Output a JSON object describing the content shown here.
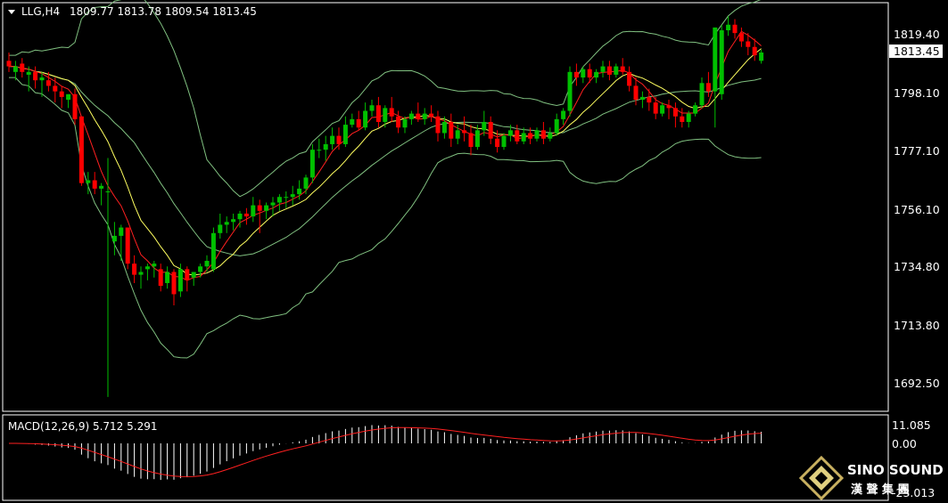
{
  "header": {
    "symbol": "LLG,H4",
    "ohlc": "1809.77 1813.78 1809.54 1813.45"
  },
  "macd": {
    "label": "MACD(12,26,9) 5.712 5.291",
    "ticks": [
      "11.085",
      "0.00",
      "-23.013"
    ]
  },
  "price_axis": {
    "ticks": [
      "1819.40",
      "1798.10",
      "1777.10",
      "1756.10",
      "1734.80",
      "1713.80",
      "1692.50"
    ],
    "current": "1813.45"
  },
  "brand": {
    "name": "SINO SOUND",
    "cn": "漢 聲 集 團"
  },
  "colors": {
    "background": "#000000",
    "up": "#00c000",
    "down": "#ff0000",
    "bollinger": "#80c080",
    "ma_fast": "#ff2020",
    "ma_slow": "#ffff60",
    "macd_hist": "#ffffff",
    "macd_signal": "#ff2020"
  },
  "chart_data": {
    "type": "candlestick",
    "symbol": "LLG",
    "timeframe": "H4",
    "y_ticks": [
      1819.4,
      1798.1,
      1777.1,
      1756.1,
      1734.8,
      1713.8,
      1692.5
    ],
    "last_price": 1813.45,
    "candles": [
      [
        1810,
        1813,
        1808,
        1806
      ],
      [
        1806,
        1810,
        1808,
        1803
      ],
      [
        1809,
        1811,
        1806,
        1804
      ],
      [
        1805,
        1808,
        1806,
        1799
      ],
      [
        1806,
        1808,
        1803,
        1800
      ],
      [
        1803,
        1806,
        1804,
        1797
      ],
      [
        1803,
        1806,
        1801,
        1799
      ],
      [
        1801,
        1804,
        1799,
        1795
      ],
      [
        1799,
        1801,
        1797,
        1793
      ],
      [
        1796,
        1798,
        1798,
        1793
      ],
      [
        1798,
        1800,
        1789,
        1787
      ],
      [
        1790,
        1790,
        1766,
        1765
      ],
      [
        1766,
        1770,
        1767,
        1762
      ],
      [
        1767,
        1770,
        1764,
        1762
      ],
      [
        1764,
        1766,
        1765,
        1758
      ],
      [
        1763,
        1775,
        1763,
        1689
      ],
      [
        1745,
        1752,
        1747,
        1740
      ],
      [
        1747,
        1751,
        1750,
        1738
      ],
      [
        1750,
        1749,
        1737,
        1735
      ],
      [
        1737,
        1740,
        1733,
        1730
      ],
      [
        1733,
        1736,
        1734,
        1728
      ],
      [
        1735,
        1737,
        1736,
        1731
      ],
      [
        1736,
        1738,
        1737,
        1732
      ],
      [
        1735,
        1737,
        1729,
        1727
      ],
      [
        1730,
        1736,
        1734,
        1728
      ],
      [
        1734,
        1735,
        1726,
        1722
      ],
      [
        1727,
        1737,
        1735,
        1725
      ],
      [
        1735,
        1736,
        1731,
        1727
      ],
      [
        1732,
        1734,
        1734,
        1729
      ],
      [
        1734,
        1737,
        1736,
        1732
      ],
      [
        1736,
        1740,
        1738,
        1734
      ],
      [
        1735,
        1750,
        1748,
        1734
      ],
      [
        1748,
        1755,
        1751,
        1746
      ],
      [
        1751,
        1754,
        1752,
        1748
      ],
      [
        1752,
        1755,
        1753,
        1749
      ],
      [
        1753,
        1756,
        1755,
        1750
      ],
      [
        1755,
        1757,
        1754,
        1751
      ],
      [
        1754,
        1761,
        1758,
        1752
      ],
      [
        1758,
        1760,
        1756,
        1748
      ],
      [
        1756,
        1759,
        1758,
        1753
      ],
      [
        1758,
        1761,
        1759,
        1754
      ],
      [
        1759,
        1762,
        1761,
        1756
      ],
      [
        1761,
        1763,
        1761,
        1757
      ],
      [
        1761,
        1765,
        1762,
        1758
      ],
      [
        1762,
        1767,
        1764,
        1760
      ],
      [
        1764,
        1769,
        1768,
        1762
      ],
      [
        1768,
        1780,
        1778,
        1766
      ],
      [
        1778,
        1782,
        1778,
        1775
      ],
      [
        1778,
        1783,
        1780,
        1774
      ],
      [
        1780,
        1786,
        1783,
        1778
      ],
      [
        1783,
        1786,
        1780,
        1778
      ],
      [
        1780,
        1790,
        1787,
        1779
      ],
      [
        1787,
        1791,
        1789,
        1786
      ],
      [
        1789,
        1792,
        1786,
        1785
      ],
      [
        1786,
        1795,
        1792,
        1785
      ],
      [
        1792,
        1796,
        1794,
        1790
      ],
      [
        1794,
        1797,
        1788,
        1786
      ],
      [
        1788,
        1794,
        1793,
        1786
      ],
      [
        1793,
        1797,
        1790,
        1788
      ],
      [
        1790,
        1792,
        1786,
        1784
      ],
      [
        1786,
        1790,
        1789,
        1784
      ],
      [
        1789,
        1792,
        1791,
        1787
      ],
      [
        1791,
        1795,
        1789,
        1788
      ],
      [
        1789,
        1793,
        1791,
        1787
      ],
      [
        1791,
        1794,
        1790,
        1788
      ],
      [
        1790,
        1792,
        1784,
        1781
      ],
      [
        1784,
        1790,
        1788,
        1782
      ],
      [
        1788,
        1791,
        1782,
        1779
      ],
      [
        1782,
        1787,
        1785,
        1780
      ],
      [
        1785,
        1790,
        1784,
        1781
      ],
      [
        1784,
        1787,
        1779,
        1776
      ],
      [
        1779,
        1787,
        1785,
        1778
      ],
      [
        1785,
        1792,
        1788,
        1783
      ],
      [
        1788,
        1790,
        1782,
        1780
      ],
      [
        1782,
        1785,
        1779,
        1777
      ],
      [
        1779,
        1784,
        1783,
        1778
      ],
      [
        1783,
        1787,
        1785,
        1781
      ],
      [
        1785,
        1787,
        1781,
        1780
      ],
      [
        1781,
        1786,
        1784,
        1780
      ],
      [
        1784,
        1786,
        1782,
        1780
      ],
      [
        1782,
        1786,
        1785,
        1781
      ],
      [
        1785,
        1788,
        1782,
        1780
      ],
      [
        1782,
        1786,
        1784,
        1781
      ],
      [
        1784,
        1791,
        1789,
        1783
      ],
      [
        1789,
        1793,
        1792,
        1787
      ],
      [
        1792,
        1808,
        1806,
        1790
      ],
      [
        1806,
        1809,
        1804,
        1801
      ],
      [
        1804,
        1808,
        1807,
        1802
      ],
      [
        1807,
        1809,
        1804,
        1802
      ],
      [
        1804,
        1807,
        1806,
        1802
      ],
      [
        1806,
        1810,
        1808,
        1804
      ],
      [
        1808,
        1810,
        1805,
        1803
      ],
      [
        1805,
        1809,
        1808,
        1804
      ],
      [
        1808,
        1811,
        1806,
        1805
      ],
      [
        1806,
        1808,
        1801,
        1799
      ],
      [
        1801,
        1804,
        1796,
        1794
      ],
      [
        1796,
        1799,
        1797,
        1793
      ],
      [
        1797,
        1800,
        1795,
        1792
      ],
      [
        1795,
        1797,
        1791,
        1789
      ],
      [
        1791,
        1795,
        1794,
        1790
      ],
      [
        1794,
        1796,
        1793,
        1789
      ],
      [
        1793,
        1795,
        1790,
        1786
      ],
      [
        1790,
        1793,
        1788,
        1786
      ],
      [
        1788,
        1792,
        1791,
        1786
      ],
      [
        1791,
        1795,
        1794,
        1790
      ],
      [
        1794,
        1804,
        1802,
        1793
      ],
      [
        1802,
        1806,
        1799,
        1797
      ],
      [
        1799,
        1806,
        1822,
        1786
      ],
      [
        1798,
        1823,
        1821,
        1796
      ],
      [
        1821,
        1826,
        1823,
        1819
      ],
      [
        1823,
        1825,
        1820,
        1818
      ],
      [
        1820,
        1822,
        1817,
        1815
      ],
      [
        1817,
        1820,
        1815,
        1812
      ],
      [
        1815,
        1818,
        1812,
        1810
      ],
      [
        1810,
        1814,
        1813,
        1809
      ]
    ],
    "bollinger_upper_edge": [
      1825,
      1824,
      1822,
      1820,
      1818,
      1815,
      1810,
      1805,
      1800,
      1795,
      1790,
      1782,
      1775,
      1768,
      1760,
      1755,
      1756,
      1762,
      1770,
      1778,
      1783,
      1790,
      1798,
      1804,
      1810,
      1812,
      1815,
      1818,
      1822,
      1823,
      1822,
      1820,
      1820,
      1824,
      1828,
      1830,
      1832
    ],
    "macd": {
      "histogram_range": [
        -23.013,
        11.085
      ],
      "signal_color": "red"
    }
  }
}
